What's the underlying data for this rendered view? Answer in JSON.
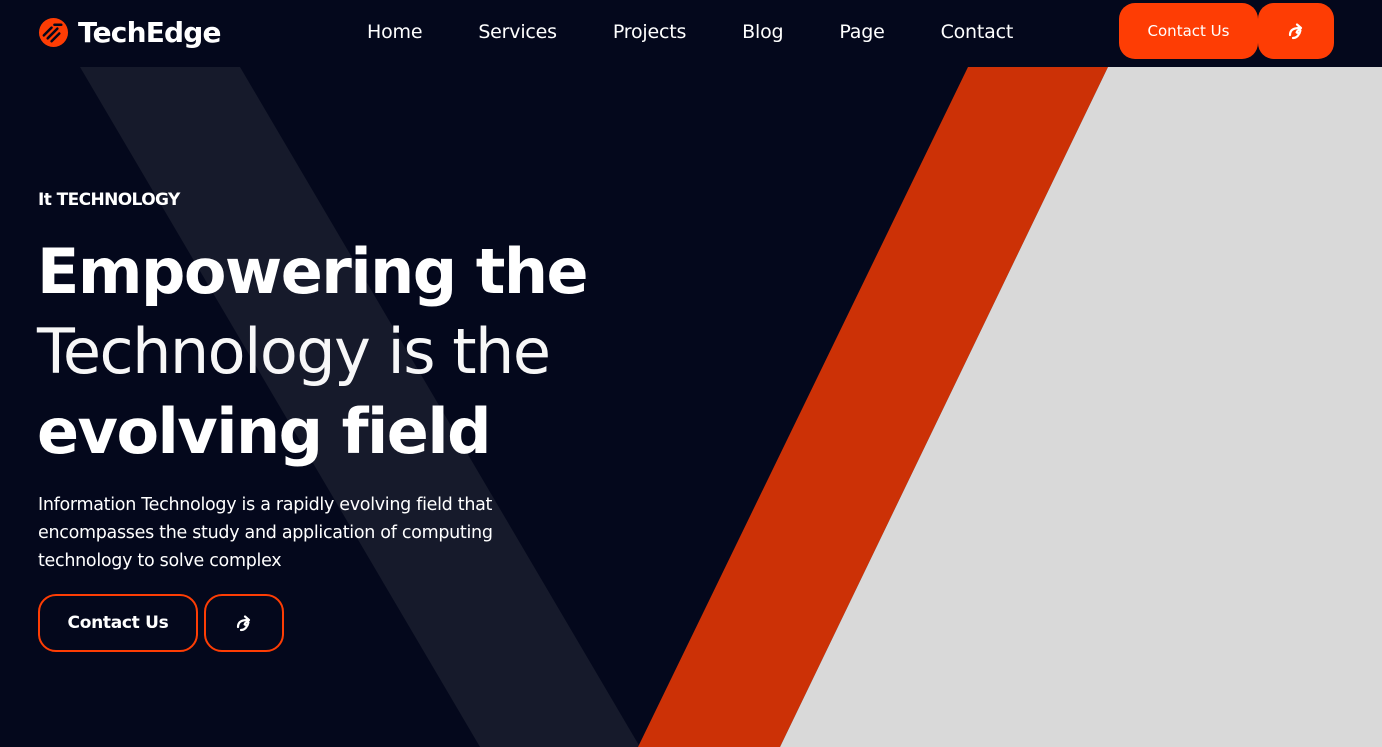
{
  "brand": {
    "name": "TechEdge",
    "logo_icon": "techedge-logo-icon"
  },
  "nav": {
    "items": [
      {
        "label": "Home"
      },
      {
        "label": "Services"
      },
      {
        "label": "Projects"
      },
      {
        "label": "Blog"
      },
      {
        "label": "Page"
      },
      {
        "label": "Contact"
      }
    ]
  },
  "header": {
    "contact_button_label": "Contact Us",
    "arrow_button_icon": "share-arrow-icon"
  },
  "hero": {
    "eyebrow": "It TECHNOLOGY",
    "headline_line1": "Empowering the",
    "headline_line2": "Technology is the",
    "headline_line3": "evolving field",
    "description": "Information Technology is a rapidly evolving field that encompasses the study and application of computing technology to solve complex",
    "contact_button_label": "Contact Us",
    "arrow_button_icon": "share-arrow-icon"
  },
  "colors": {
    "background": "#04081c",
    "accent": "#fe3d04",
    "stripe_red": "#cc3106",
    "panel_gray": "#d9d9d9",
    "diagonal_band": "#161a2b",
    "text": "#ffffff"
  }
}
